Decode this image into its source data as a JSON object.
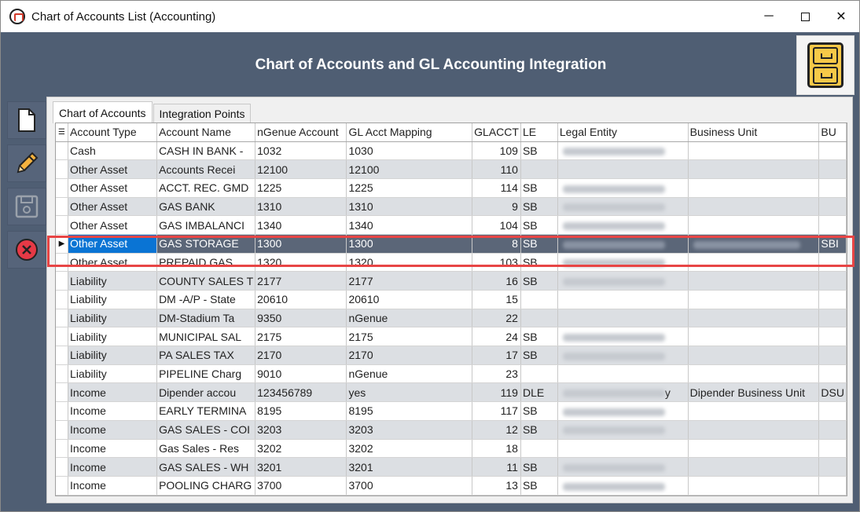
{
  "window": {
    "title": "Chart of Accounts List (Accounting)",
    "controls": {
      "minimize": "─",
      "maximize": "☐",
      "close": "✕"
    }
  },
  "header": {
    "title": "Chart of Accounts and GL Accounting Integration"
  },
  "toolbar": {
    "buttons": [
      {
        "name": "new-document-icon"
      },
      {
        "name": "edit-pencil-icon"
      },
      {
        "name": "save-icon"
      },
      {
        "name": "cancel-icon"
      }
    ]
  },
  "tabs": [
    {
      "label": "Chart of Accounts",
      "active": true
    },
    {
      "label": "Integration Points",
      "active": false
    }
  ],
  "grid": {
    "columns": [
      "Account Type",
      "Account Name",
      "nGenue Account",
      "GL Acct Mapping",
      "GLACCT",
      "LE",
      "Legal Entity",
      "Business Unit",
      "BU"
    ],
    "rows": [
      {
        "type": "Cash",
        "name": "CASH IN BANK -",
        "ngenue": "1032",
        "gl": "1030",
        "glacct": "109",
        "le": "SB",
        "legal": true,
        "bu_name": "",
        "bu": ""
      },
      {
        "type": "Other Asset",
        "name": "Accounts Recei",
        "ngenue": "12100",
        "gl": "12100",
        "glacct": "110",
        "le": "",
        "legal": false,
        "bu_name": "",
        "bu": ""
      },
      {
        "type": "Other Asset",
        "name": "ACCT. REC. GMD",
        "ngenue": "1225",
        "gl": "1225",
        "glacct": "114",
        "le": "SB",
        "legal": true,
        "bu_name": "",
        "bu": ""
      },
      {
        "type": "Other Asset",
        "name": "GAS BANK",
        "ngenue": "1310",
        "gl": "1310",
        "glacct": "9",
        "le": "SB",
        "legal": true,
        "bu_name": "",
        "bu": ""
      },
      {
        "type": "Other Asset",
        "name": "GAS IMBALANCI",
        "ngenue": "1340",
        "gl": "1340",
        "glacct": "104",
        "le": "SB",
        "legal": true,
        "bu_name": "",
        "bu": ""
      },
      {
        "type": "Other Asset",
        "name": "GAS STORAGE",
        "ngenue": "1300",
        "gl": "1300",
        "glacct": "8",
        "le": "SB",
        "legal": true,
        "bu_name": "blurred",
        "bu": "SBI",
        "selected": true
      },
      {
        "type": "Other Asset",
        "name": "PREPAID GAS",
        "ngenue": "1320",
        "gl": "1320",
        "glacct": "103",
        "le": "SB",
        "legal": true,
        "bu_name": "",
        "bu": ""
      },
      {
        "type": "Liability",
        "name": "COUNTY SALES T",
        "ngenue": "2177",
        "gl": "2177",
        "glacct": "16",
        "le": "SB",
        "legal": true,
        "bu_name": "",
        "bu": ""
      },
      {
        "type": "Liability",
        "name": "DM -A/P - State",
        "ngenue": "20610",
        "gl": "20610",
        "glacct": "15",
        "le": "",
        "legal": false,
        "bu_name": "",
        "bu": ""
      },
      {
        "type": "Liability",
        "name": "DM-Stadium Ta",
        "ngenue": "9350",
        "gl": "nGenue",
        "glacct": "22",
        "le": "",
        "legal": false,
        "bu_name": "",
        "bu": ""
      },
      {
        "type": "Liability",
        "name": "MUNICIPAL SAL",
        "ngenue": "2175",
        "gl": "2175",
        "glacct": "24",
        "le": "SB",
        "legal": true,
        "bu_name": "",
        "bu": ""
      },
      {
        "type": "Liability",
        "name": "PA SALES TAX",
        "ngenue": "2170",
        "gl": "2170",
        "glacct": "17",
        "le": "SB",
        "legal": true,
        "bu_name": "",
        "bu": ""
      },
      {
        "type": "Liability",
        "name": "PIPELINE Charg",
        "ngenue": "9010",
        "gl": "nGenue",
        "glacct": "23",
        "le": "",
        "legal": false,
        "bu_name": "",
        "bu": ""
      },
      {
        "type": "Income",
        "name": "Dipender accou",
        "ngenue": "123456789",
        "gl": "yes",
        "glacct": "119",
        "le": "DLE",
        "legal": true,
        "legal_suffix": "y",
        "bu_name": "Dipender Business Unit",
        "bu": "DSU"
      },
      {
        "type": "Income",
        "name": "EARLY TERMINA",
        "ngenue": "8195",
        "gl": "8195",
        "glacct": "117",
        "le": "SB",
        "legal": true,
        "bu_name": "",
        "bu": ""
      },
      {
        "type": "Income",
        "name": "GAS SALES - COI",
        "ngenue": "3203",
        "gl": "3203",
        "glacct": "12",
        "le": "SB",
        "legal": true,
        "bu_name": "",
        "bu": ""
      },
      {
        "type": "Income",
        "name": "Gas Sales - Res",
        "ngenue": "3202",
        "gl": "3202",
        "glacct": "18",
        "le": "",
        "legal": false,
        "bu_name": "",
        "bu": ""
      },
      {
        "type": "Income",
        "name": "GAS SALES - WH",
        "ngenue": "3201",
        "gl": "3201",
        "glacct": "11",
        "le": "SB",
        "legal": true,
        "bu_name": "",
        "bu": ""
      },
      {
        "type": "Income",
        "name": "POOLING CHARG",
        "ngenue": "3700",
        "gl": "3700",
        "glacct": "13",
        "le": "SB",
        "legal": true,
        "bu_name": "",
        "bu": ""
      }
    ]
  },
  "colors": {
    "window_bg": "#4f5e73",
    "selected_row": "#5b6678",
    "selected_cell": "#0a74d4",
    "alt_row": "#dcdfe3",
    "highlight": "#e84545"
  }
}
